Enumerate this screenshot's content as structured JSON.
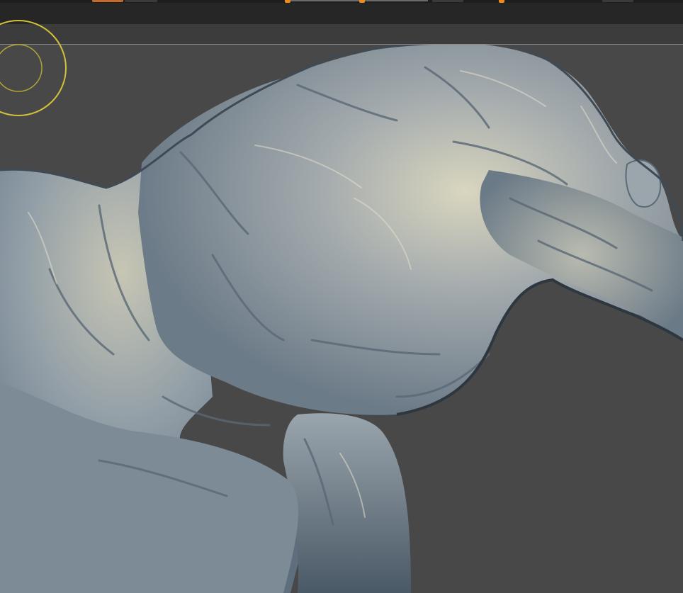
{
  "app": {
    "name": "",
    "canvas": {
      "subject": "sculpt-model",
      "background_color": "#484848",
      "model_color": "#8a97a3"
    },
    "toolbar": {
      "active_button_color": "#c46a2a",
      "slider_color": "#f08a1c"
    },
    "brush_cursor": {
      "color": "#d4c23a"
    }
  }
}
